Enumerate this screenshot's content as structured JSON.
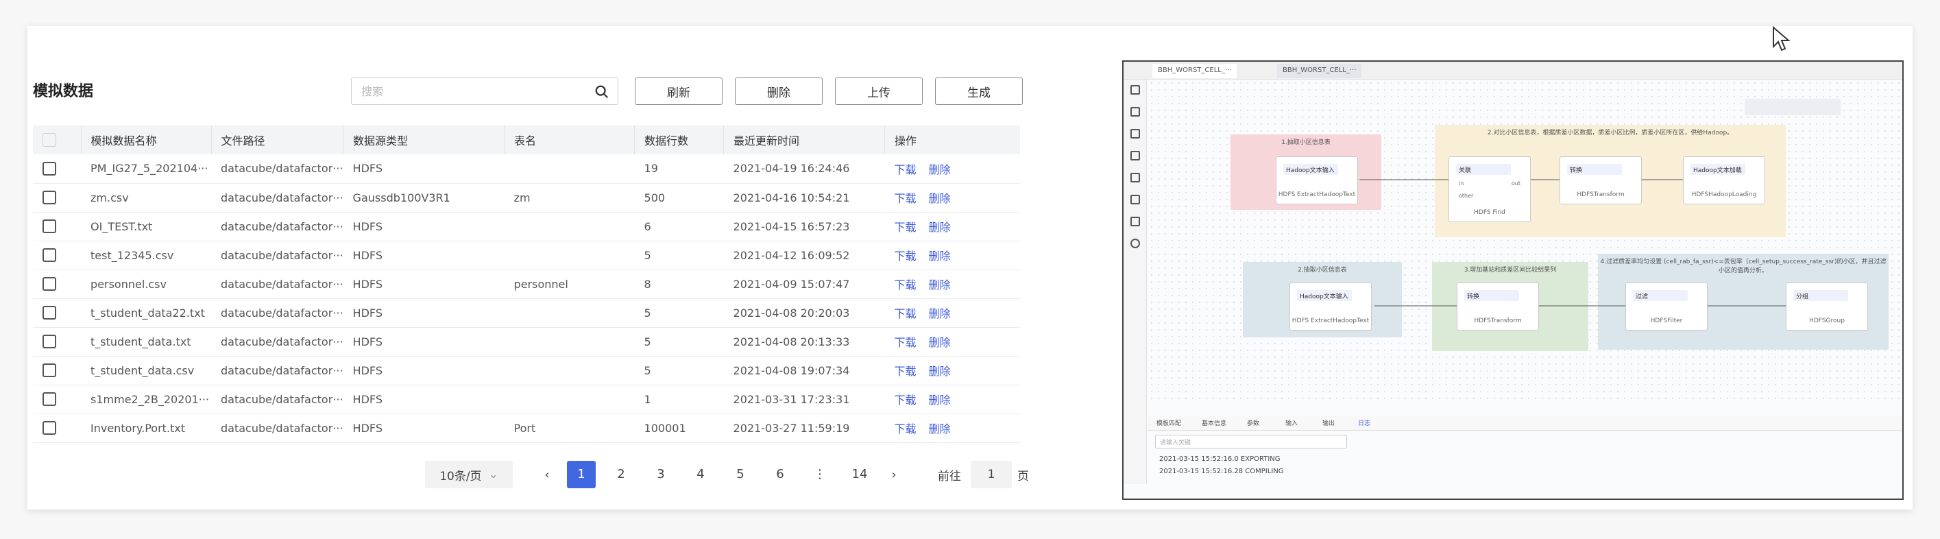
{
  "title": "模拟数据",
  "search": {
    "placeholder": "搜索"
  },
  "buttons": {
    "refresh": "刷新",
    "delete": "删除",
    "upload": "上传",
    "generate": "生成"
  },
  "table": {
    "columns": [
      "模拟数据名称",
      "文件路径",
      "数据源类型",
      "表名",
      "数据行数",
      "最近更新时间",
      "操作"
    ],
    "rows": [
      {
        "name": "PM_IG27_5_202104···",
        "path": "datacube/datafactor···",
        "type": "HDFS",
        "table": "",
        "rows": "19",
        "time": "2021-04-19 16:24:46"
      },
      {
        "name": "zm.csv",
        "path": "datacube/datafactor···",
        "type": "Gaussdb100V3R1",
        "table": "zm",
        "rows": "500",
        "time": "2021-04-16 10:54:21"
      },
      {
        "name": "OI_TEST.txt",
        "path": "datacube/datafactor···",
        "type": "HDFS",
        "table": "",
        "rows": "6",
        "time": "2021-04-15 16:57:23"
      },
      {
        "name": "test_12345.csv",
        "path": "datacube/datafactor···",
        "type": "HDFS",
        "table": "",
        "rows": "5",
        "time": "2021-04-12 16:09:52"
      },
      {
        "name": "personnel.csv",
        "path": "datacube/datafactor···",
        "type": "HDFS",
        "table": "personnel",
        "rows": "8",
        "time": "2021-04-09 15:07:47"
      },
      {
        "name": "t_student_data22.txt",
        "path": "datacube/datafactor···",
        "type": "HDFS",
        "table": "",
        "rows": "5",
        "time": "2021-04-08 20:20:03"
      },
      {
        "name": "t_student_data.txt",
        "path": "datacube/datafactor···",
        "type": "HDFS",
        "table": "",
        "rows": "5",
        "time": "2021-04-08 20:13:33"
      },
      {
        "name": "t_student_data.csv",
        "path": "datacube/datafactor···",
        "type": "HDFS",
        "table": "",
        "rows": "5",
        "time": "2021-04-08 19:07:34"
      },
      {
        "name": "s1mme2_2B_20201···",
        "path": "datacube/datafactor···",
        "type": "HDFS",
        "table": "",
        "rows": "1",
        "time": "2021-03-31 17:23:31"
      },
      {
        "name": "Inventory.Port.txt",
        "path": "datacube/datafactor···",
        "type": "HDFS",
        "table": "Port",
        "rows": "100001",
        "time": "2021-03-27 11:59:19"
      }
    ],
    "op_download": "下载",
    "op_delete": "删除"
  },
  "pagination": {
    "page_size": "10条/页",
    "pages": [
      "1",
      "2",
      "3",
      "4",
      "5",
      "6",
      "⋮",
      "14"
    ],
    "current": "1",
    "goto_label": "前往",
    "goto_value": "1",
    "goto_suffix": "页"
  },
  "editor": {
    "tabs": [
      "BBH_WORST_CELL_···",
      "BBH_WORST_CELL_···"
    ],
    "groups": [
      "1.抽取小区信息表",
      "2.对比小区信息表，根据质差小区数据，质差小区比例，质差小区所在区，供给Hadoop。",
      "2.抽取小区信息表",
      "3.增加基站和质差区间比较结果列",
      "4.过滤质差率均匀设置 (cell_rab_fa_ssr)<=丢包率（cell_setup_success_rate_ssr)的小区，并且过滤小区的值再分析。"
    ],
    "nodes": {
      "n1": {
        "head": "Hadoop文本输入",
        "name": "HDFS ExtractHadoopText"
      },
      "n2": {
        "head": "关联",
        "name": "HDFS Find",
        "ports": [
          "in",
          "out",
          "other"
        ]
      },
      "n3": {
        "head": "转换",
        "name": "HDFSTransform"
      },
      "n4": {
        "head": "Hadoop文本加载",
        "name": "HDFSHadoopLoading"
      },
      "n5": {
        "head": "Hadoop文本输入",
        "name": "HDFS ExtractHadoopText"
      },
      "n6": {
        "head": "转换",
        "name": "HDFSTransform"
      },
      "n7": {
        "head": "过滤",
        "name": "HDFSFilter"
      },
      "n8": {
        "head": "分组",
        "name": "HDFSGroup"
      }
    },
    "bottom_tabs": [
      "模板匹配",
      "基本信息",
      "参数",
      "输入",
      "输出",
      "日志"
    ],
    "log_search": "请输入关键",
    "logs": [
      "2021-03-15 15:52:16.0 EXPORTING",
      "2021-03-15 15:52:16.28 COMPILING"
    ]
  }
}
